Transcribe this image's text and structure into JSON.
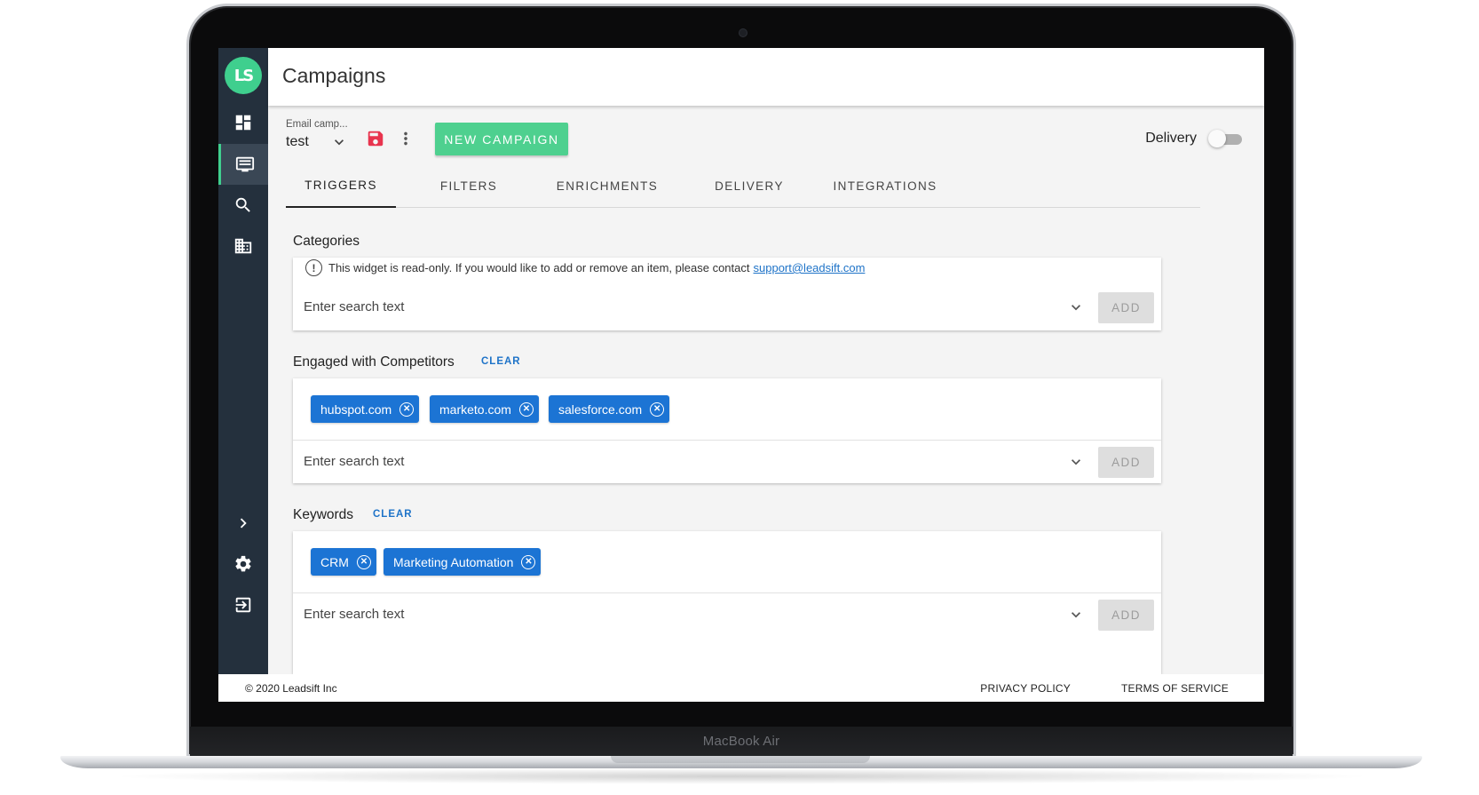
{
  "device": {
    "label": "MacBook Air"
  },
  "app": {
    "logo": "LS",
    "page_title": "Campaigns"
  },
  "sidebar": {
    "items": [
      {
        "icon": "dashboard-icon"
      },
      {
        "icon": "campaigns-icon",
        "active": true
      },
      {
        "icon": "search-icon"
      },
      {
        "icon": "company-icon"
      }
    ],
    "bottom": [
      {
        "icon": "chevron-right-icon"
      },
      {
        "icon": "gear-icon"
      },
      {
        "icon": "logout-icon"
      }
    ]
  },
  "toolbar": {
    "campaign_label": "Email camp...",
    "campaign_value": "test",
    "new_campaign_label": "NEW CAMPAIGN",
    "delivery_label": "Delivery",
    "delivery_enabled": false,
    "accent": "#4ed08f",
    "save_color": "#e8344e"
  },
  "tabs": [
    {
      "label": "TRIGGERS",
      "active": true
    },
    {
      "label": "FILTERS"
    },
    {
      "label": "ENRICHMENTS"
    },
    {
      "label": "DELIVERY"
    },
    {
      "label": "INTEGRATIONS"
    }
  ],
  "categories": {
    "title": "Categories",
    "info_text": "This widget is read-only. If you would like to add or remove an item, please contact",
    "support_email": "support@leadsift.com",
    "search_placeholder": "Enter search text",
    "add_label": "ADD"
  },
  "competitors": {
    "title": "Engaged with Competitors",
    "clear_label": "CLEAR",
    "chips": [
      "hubspot.com",
      "marketo.com",
      "salesforce.com"
    ],
    "search_placeholder": "Enter search text",
    "add_label": "ADD"
  },
  "keywords": {
    "title": "Keywords",
    "clear_label": "CLEAR",
    "chips": [
      "CRM",
      "Marketing Automation"
    ],
    "search_placeholder": "Enter search text",
    "add_label": "ADD"
  },
  "footer": {
    "copyright": "© 2020 Leadsift Inc",
    "privacy": "PRIVACY POLICY",
    "terms": "TERMS OF SERVICE"
  }
}
